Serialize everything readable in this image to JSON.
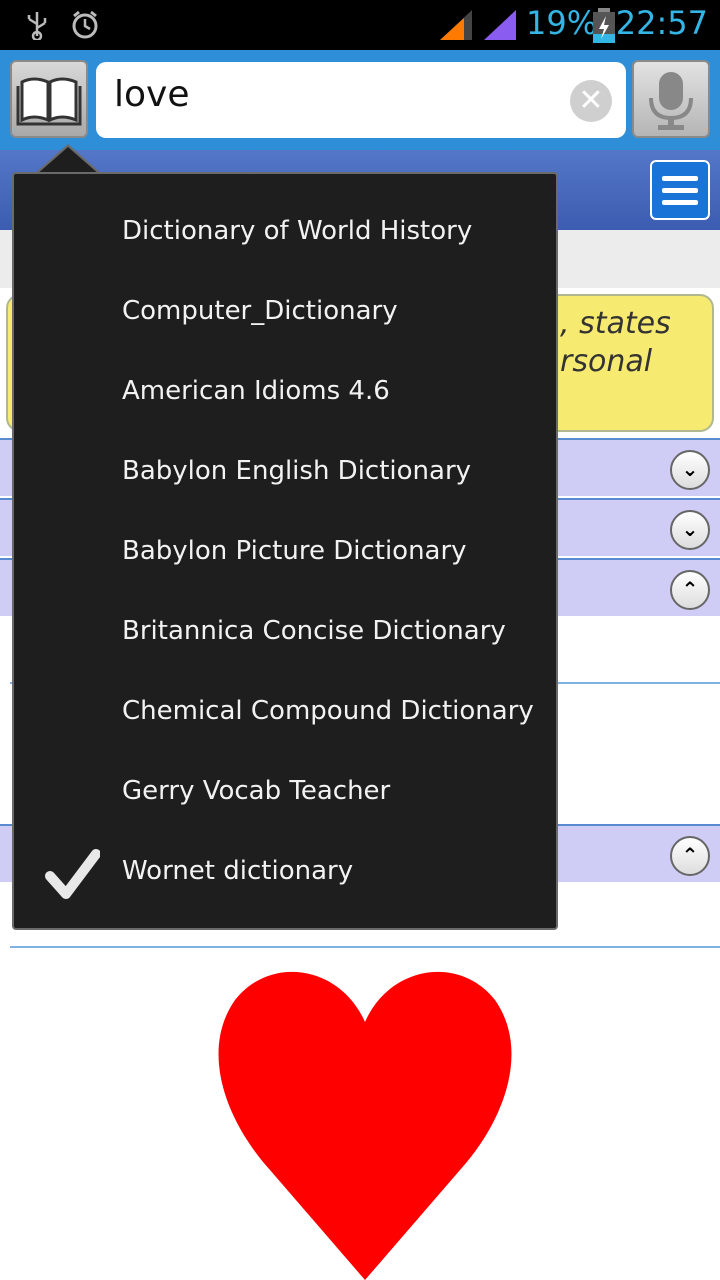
{
  "status_bar": {
    "battery_percent": "19%",
    "time": "22:57",
    "icons": [
      "usb-icon",
      "alarm-icon",
      "signal-icon",
      "battery-charging-icon"
    ]
  },
  "search": {
    "query": "love"
  },
  "background": {
    "definition_fragment_line1": ", states",
    "definition_fragment_line2": "rsonal"
  },
  "dictionary_menu": {
    "items": [
      {
        "label": "Dictionary of World History",
        "checked": false
      },
      {
        "label": "Computer_Dictionary",
        "checked": false
      },
      {
        "label": "American Idioms 4.6",
        "checked": false
      },
      {
        "label": "Babylon English Dictionary",
        "checked": false
      },
      {
        "label": "Babylon Picture Dictionary",
        "checked": false
      },
      {
        "label": "Britannica Concise Dictionary",
        "checked": false
      },
      {
        "label": "Chemical Compound Dictionary",
        "checked": false
      },
      {
        "label": "Gerry Vocab Teacher",
        "checked": false
      },
      {
        "label": "Wornet dictionary",
        "checked": true
      }
    ]
  },
  "colors": {
    "accent": "#33b5e5",
    "header_blue": "#2e8fd8",
    "popup_bg": "#1e1e1e",
    "highlight_yellow": "#f7ea70",
    "section_lavender": "#cfcdf6",
    "heart_red": "#ff0000"
  }
}
